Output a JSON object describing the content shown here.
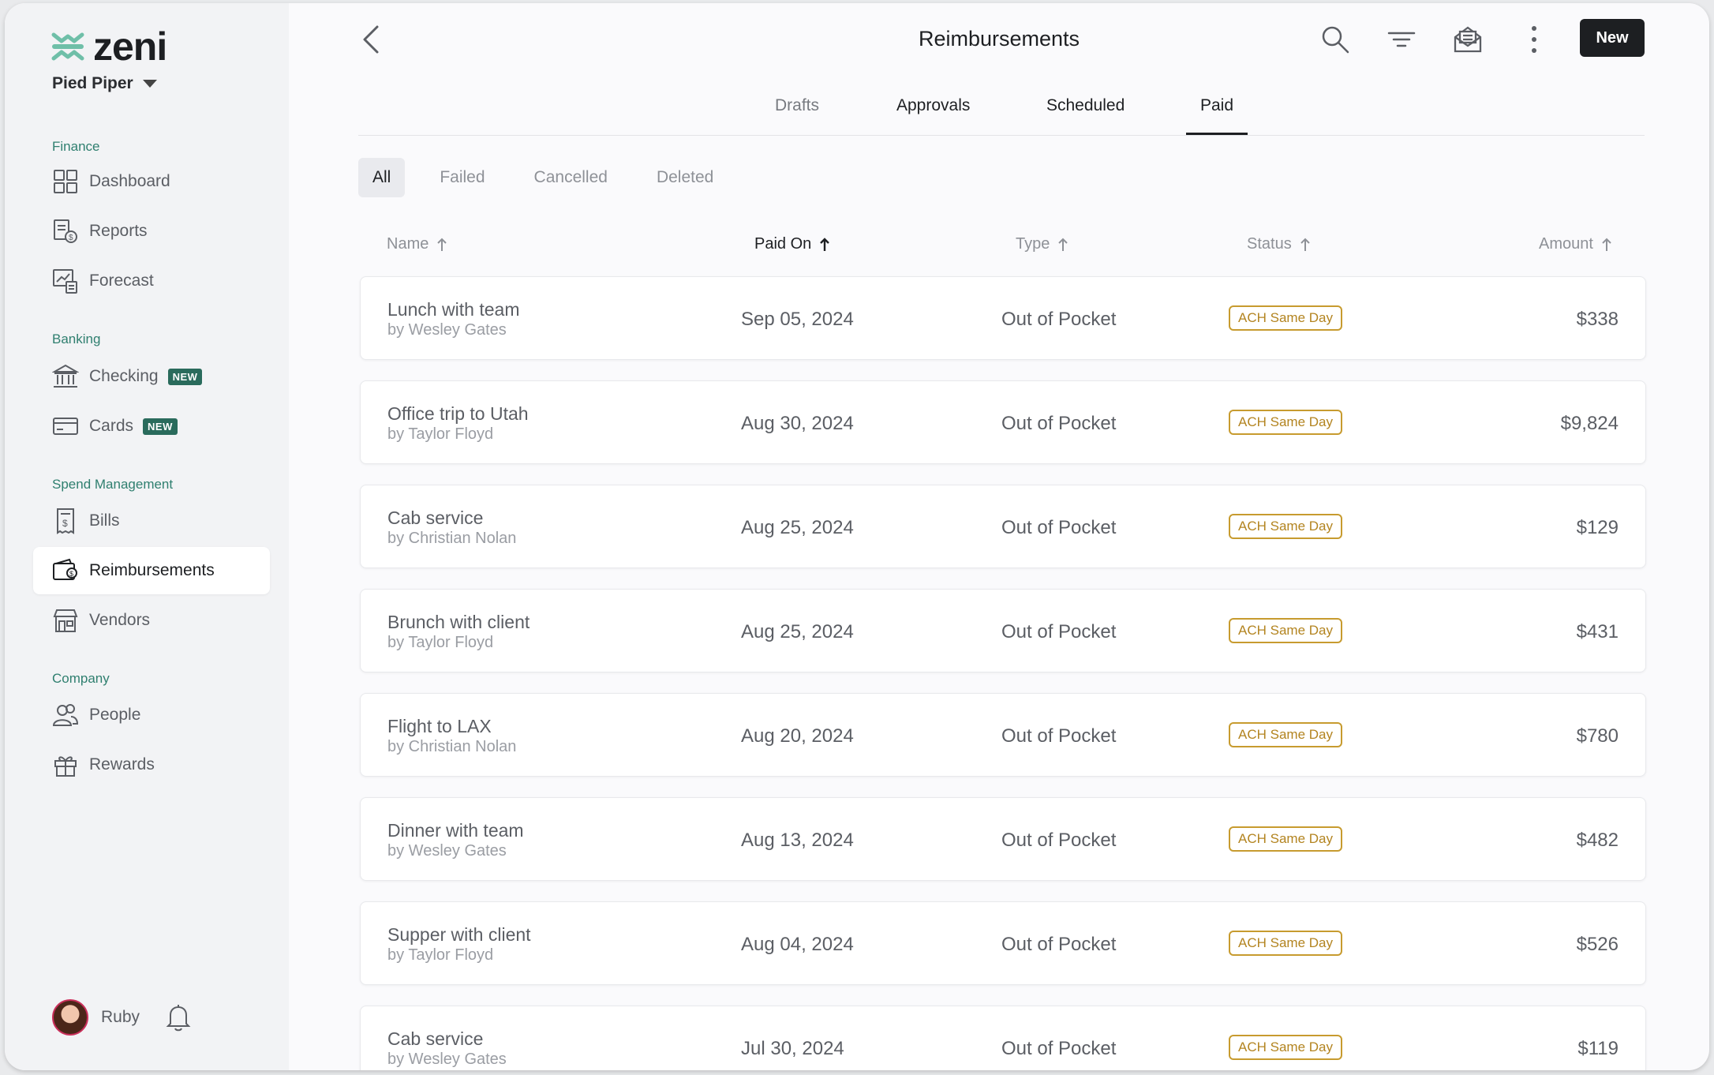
{
  "brand": {
    "name": "zeni",
    "company": "Pied Piper"
  },
  "sidebar": {
    "sections": [
      {
        "label": "Finance",
        "items": [
          {
            "label": "Dashboard",
            "icon": "dashboard-icon"
          },
          {
            "label": "Reports",
            "icon": "reports-icon"
          },
          {
            "label": "Forecast",
            "icon": "forecast-icon"
          }
        ]
      },
      {
        "label": "Banking",
        "items": [
          {
            "label": "Checking",
            "icon": "bank-icon",
            "badge": "NEW"
          },
          {
            "label": "Cards",
            "icon": "card-icon",
            "badge": "NEW"
          }
        ]
      },
      {
        "label": "Spend Management",
        "items": [
          {
            "label": "Bills",
            "icon": "bill-icon"
          },
          {
            "label": "Reimbursements",
            "icon": "wallet-icon",
            "active": true
          },
          {
            "label": "Vendors",
            "icon": "store-icon"
          }
        ]
      },
      {
        "label": "Company",
        "items": [
          {
            "label": "People",
            "icon": "people-icon"
          },
          {
            "label": "Rewards",
            "icon": "gift-icon"
          }
        ]
      }
    ],
    "user": {
      "name": "Ruby"
    }
  },
  "header": {
    "title": "Reimbursements",
    "new_label": "New"
  },
  "tabs": [
    {
      "label": "Drafts"
    },
    {
      "label": "Approvals"
    },
    {
      "label": "Scheduled"
    },
    {
      "label": "Paid",
      "active": true
    }
  ],
  "filters": [
    {
      "label": "All",
      "active": true
    },
    {
      "label": "Failed"
    },
    {
      "label": "Cancelled"
    },
    {
      "label": "Deleted"
    }
  ],
  "columns": {
    "name": "Name",
    "paid_on": "Paid On",
    "type": "Type",
    "status": "Status",
    "amount": "Amount"
  },
  "rows": [
    {
      "name": "Lunch with team",
      "by": "by Wesley Gates",
      "date": "Sep 05, 2024",
      "type": "Out of Pocket",
      "status": "ACH Same Day",
      "amount": "$338"
    },
    {
      "name": "Office trip to Utah",
      "by": "by Taylor Floyd",
      "date": "Aug 30, 2024",
      "type": "Out of Pocket",
      "status": "ACH Same Day",
      "amount": "$9,824"
    },
    {
      "name": "Cab service",
      "by": "by Christian Nolan",
      "date": "Aug 25, 2024",
      "type": "Out of Pocket",
      "status": "ACH Same Day",
      "amount": "$129"
    },
    {
      "name": "Brunch with client",
      "by": "by Taylor Floyd",
      "date": "Aug 25, 2024",
      "type": "Out of Pocket",
      "status": "ACH Same Day",
      "amount": "$431"
    },
    {
      "name": "Flight to LAX",
      "by": "by Christian Nolan",
      "date": "Aug 20, 2024",
      "type": "Out of Pocket",
      "status": "ACH Same Day",
      "amount": "$780"
    },
    {
      "name": "Dinner with team",
      "by": "by Wesley Gates",
      "date": "Aug 13, 2024",
      "type": "Out of Pocket",
      "status": "ACH Same Day",
      "amount": "$482"
    },
    {
      "name": "Supper with client",
      "by": "by Taylor Floyd",
      "date": "Aug 04, 2024",
      "type": "Out of Pocket",
      "status": "ACH Same Day",
      "amount": "$526"
    },
    {
      "name": "Cab service",
      "by": "by Wesley Gates",
      "date": "Jul 30, 2024",
      "type": "Out of Pocket",
      "status": "ACH Same Day",
      "amount": "$119"
    }
  ],
  "colors": {
    "accent": "#2a6b5c",
    "status": "#c79b2f",
    "primary_button": "#1d1f22"
  }
}
